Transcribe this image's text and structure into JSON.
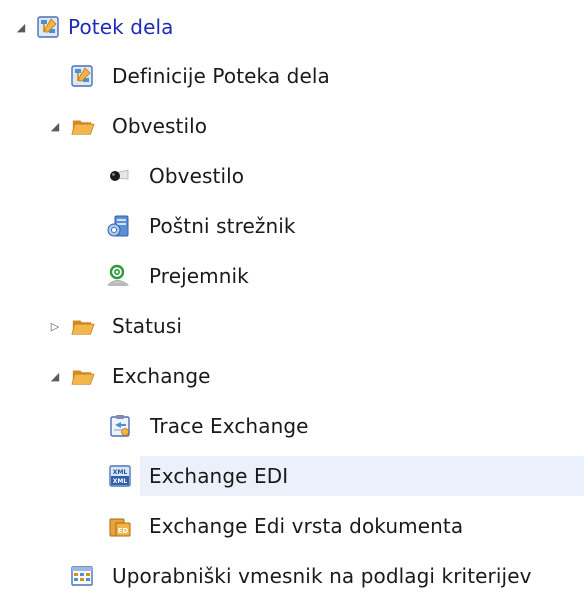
{
  "tree": {
    "root": {
      "label": "Potek dela",
      "expanded": true,
      "icon": "workflow-icon"
    },
    "items": [
      {
        "label": "Definicije Poteka dela",
        "icon": "workflow-definition-icon"
      },
      {
        "label": "Obvestilo",
        "icon": "folder-icon",
        "expanded": true
      },
      {
        "label": "Obvestilo",
        "icon": "notification-icon"
      },
      {
        "label": "Poštni strežnik",
        "icon": "mail-server-icon"
      },
      {
        "label": "Prejemnik",
        "icon": "recipient-icon"
      },
      {
        "label": "Statusi",
        "icon": "folder-icon",
        "expanded": false
      },
      {
        "label": "Exchange",
        "icon": "folder-icon",
        "expanded": true
      },
      {
        "label": "Trace Exchange",
        "icon": "trace-exchange-icon"
      },
      {
        "label": "Exchange EDI",
        "icon": "xml-document-icon",
        "selected": true
      },
      {
        "label": "Exchange Edi vrsta dokumenta",
        "icon": "document-type-icon"
      },
      {
        "label": "Uporabniški vmesnik na podlagi kriterijev",
        "icon": "grid-ui-icon"
      }
    ]
  },
  "colors": {
    "root_text": "#1f2bb8",
    "selected_background": "#eaf1fb",
    "folder": "#e8a33a"
  }
}
